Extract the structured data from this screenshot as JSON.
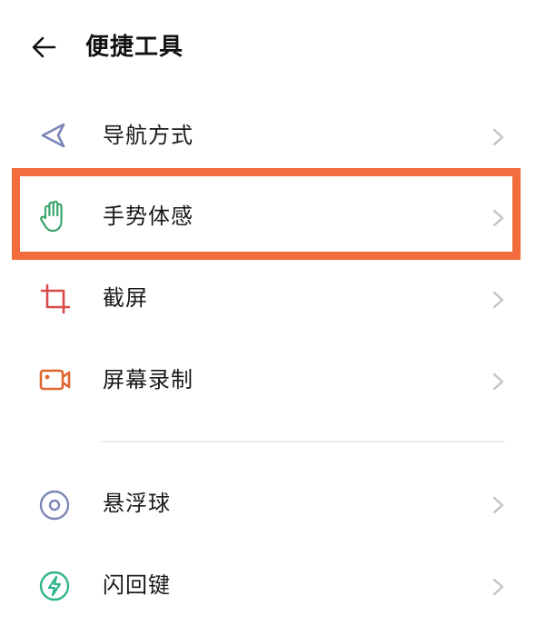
{
  "header": {
    "title": "便捷工具",
    "back_icon": "arrow-left-icon"
  },
  "items": [
    {
      "label": "导航方式",
      "icon": "navigation-arrow-icon",
      "icon_color": "#7b86b8"
    },
    {
      "label": "手势体感",
      "icon": "hand-gesture-icon",
      "icon_color": "#3aa66b",
      "highlighted": true
    },
    {
      "label": "截屏",
      "icon": "crop-icon",
      "icon_color": "#d84b4b"
    },
    {
      "label": "屏幕录制",
      "icon": "video-camera-icon",
      "icon_color": "#e0652e"
    },
    {
      "label": "悬浮球",
      "icon": "floating-ball-icon",
      "icon_color": "#7b86b8"
    },
    {
      "label": "闪回键",
      "icon": "flash-key-icon",
      "icon_color": "#2fb38c"
    }
  ],
  "colors": {
    "highlight_border": "#f26c3d",
    "chevron": "#c4c4c4",
    "divider": "#ececec"
  }
}
